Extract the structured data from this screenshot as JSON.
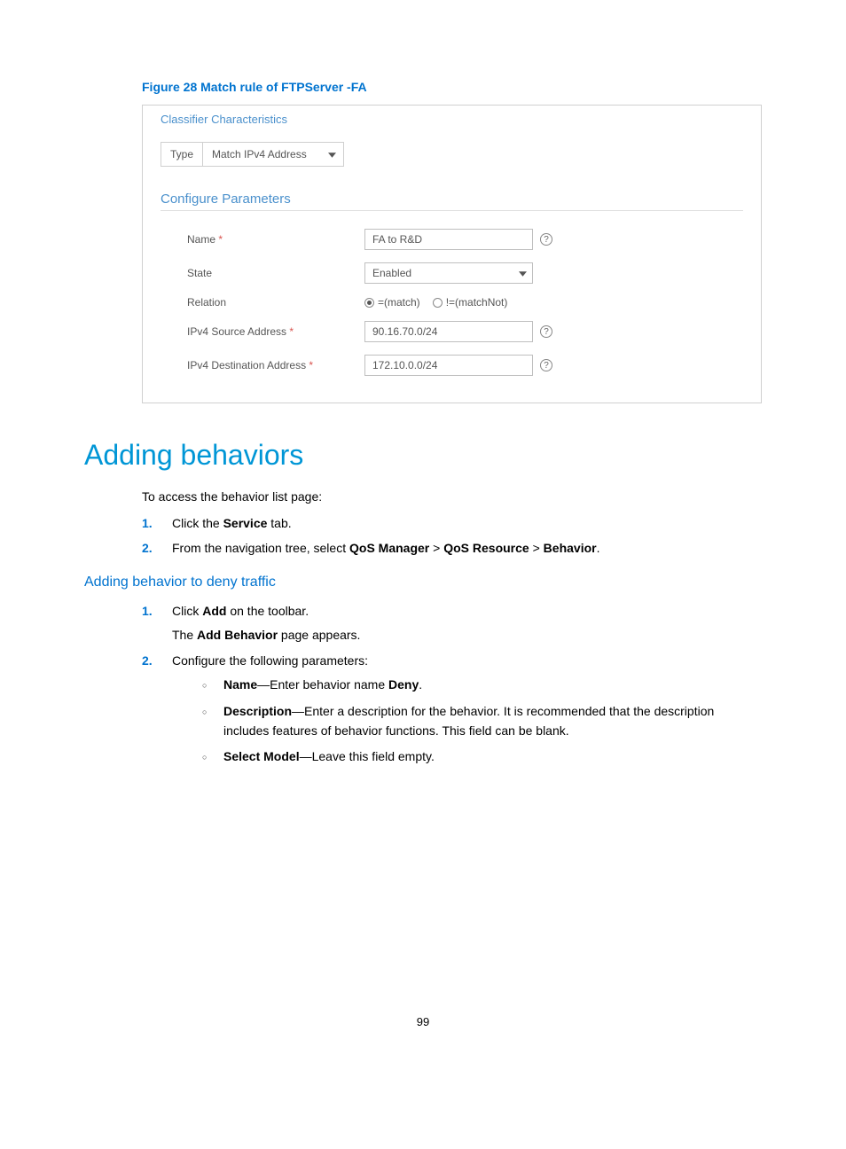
{
  "figure_caption": "Figure 28 Match rule of FTPServer -FA",
  "panel": {
    "title": "Classifier Characteristics",
    "type_label": "Type",
    "type_value": "Match IPv4 Address",
    "subsection": "Configure Parameters",
    "fields": {
      "name_label": "Name",
      "name_value": "FA to R&D",
      "state_label": "State",
      "state_value": "Enabled",
      "relation_label": "Relation",
      "relation_opt1": "=(match)",
      "relation_opt2": "!=(matchNot)",
      "src_label": "IPv4 Source Address",
      "src_value": "90.16.70.0/24",
      "dst_label": "IPv4 Destination Address",
      "dst_value": "172.10.0.0/24"
    }
  },
  "heading": "Adding behaviors",
  "intro": "To access the behavior list page:",
  "step1_pre": "Click the ",
  "step1_bold": "Service",
  "step1_post": " tab.",
  "step2_pre": "From the navigation tree, select ",
  "step2_b1": "QoS Manager",
  "step2_sep": " > ",
  "step2_b2": "QoS Resource",
  "step2_b3": "Behavior",
  "step2_end": ".",
  "subheading": "Adding behavior to deny traffic",
  "sub_step1_pre": "Click ",
  "sub_step1_bold": "Add",
  "sub_step1_post": " on the toolbar.",
  "sub_step1_line2_pre": "The ",
  "sub_step1_line2_bold": "Add Behavior",
  "sub_step1_line2_post": " page appears.",
  "sub_step2": "Configure the following parameters:",
  "bullet1_b": "Name",
  "bullet1_mid": "—Enter behavior name ",
  "bullet1_b2": "Deny",
  "bullet1_end": ".",
  "bullet2_b": "Description",
  "bullet2_text": "—Enter a description for the behavior. It is recommended that the description includes features of behavior functions. This field can be blank.",
  "bullet3_b": "Select Model",
  "bullet3_text": "—Leave this field empty.",
  "page_number": "99",
  "help_glyph": "?"
}
